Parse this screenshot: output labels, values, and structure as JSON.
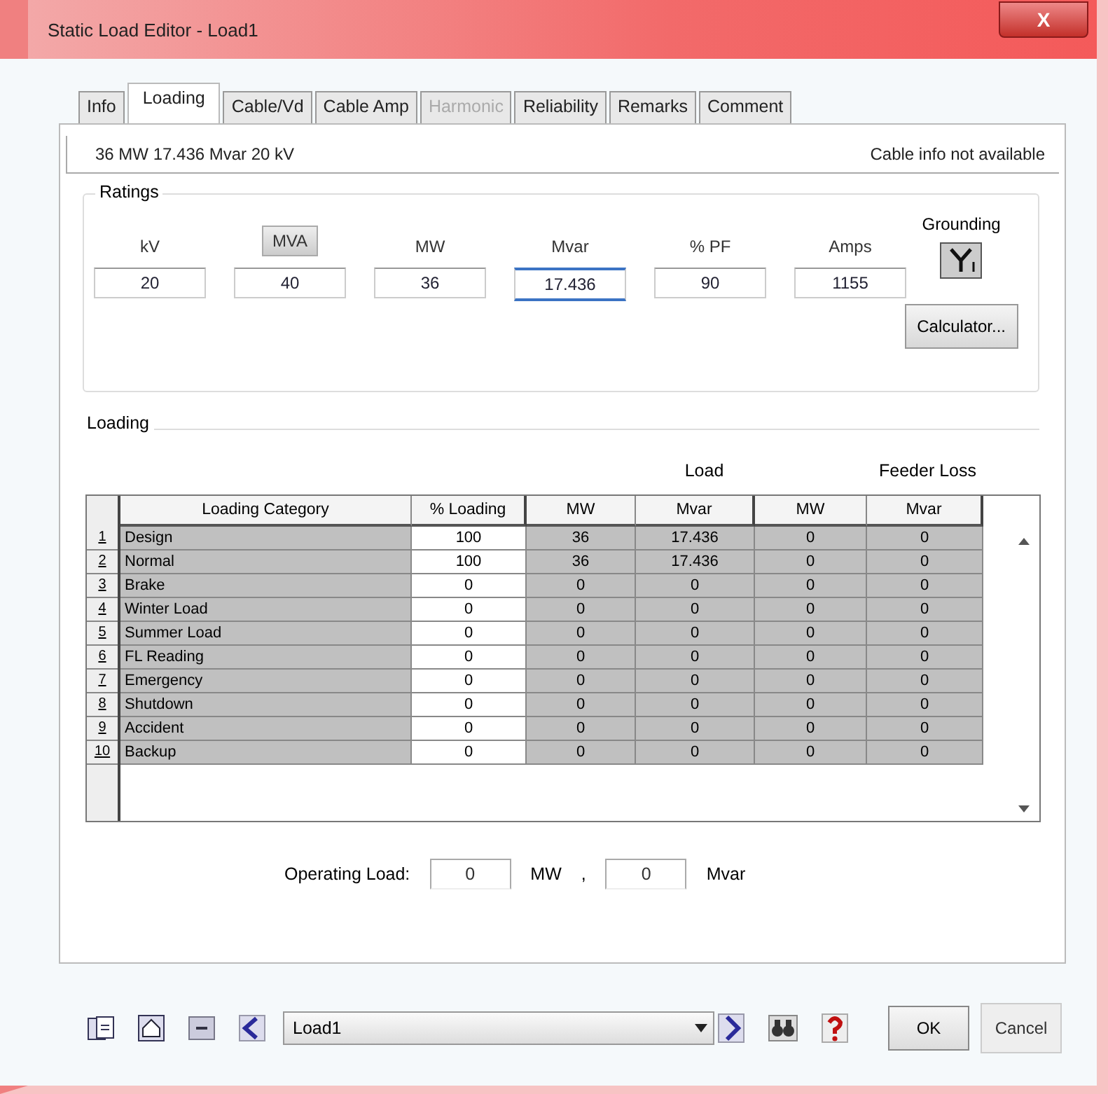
{
  "window": {
    "title": "Static Load Editor - Load1",
    "close": "X"
  },
  "tabs": [
    {
      "label": "Info",
      "selected": false,
      "disabled": false
    },
    {
      "label": "Loading",
      "selected": true,
      "disabled": false
    },
    {
      "label": "Cable/Vd",
      "selected": false,
      "disabled": false
    },
    {
      "label": "Cable Amp",
      "selected": false,
      "disabled": false
    },
    {
      "label": "Harmonic",
      "selected": false,
      "disabled": true
    },
    {
      "label": "Reliability",
      "selected": false,
      "disabled": false
    },
    {
      "label": "Remarks",
      "selected": false,
      "disabled": false
    },
    {
      "label": "Comment",
      "selected": false,
      "disabled": false
    }
  ],
  "summary": {
    "text": "36 MW   17.436 Mvar   20 kV",
    "cable_info": "Cable info not available"
  },
  "ratings": {
    "title": "Ratings",
    "fields": [
      {
        "label": "kV",
        "kind": "label",
        "value": "20",
        "focused": false
      },
      {
        "label": "MVA",
        "kind": "button",
        "value": "40",
        "focused": false
      },
      {
        "label": "MW",
        "kind": "label",
        "value": "36",
        "focused": false
      },
      {
        "label": "Mvar",
        "kind": "label",
        "value": "17.436",
        "focused": true
      },
      {
        "label": "% PF",
        "kind": "label",
        "value": "90",
        "focused": false
      },
      {
        "label": "Amps",
        "kind": "label",
        "value": "1155",
        "focused": false
      }
    ],
    "grounding_label": "Grounding",
    "calculator": "Calculator..."
  },
  "loading": {
    "title": "Loading",
    "group_headers": [
      "Load",
      "Feeder Loss"
    ],
    "columns": [
      "Loading Category",
      "% Loading",
      "MW",
      "Mvar",
      "MW",
      "Mvar"
    ],
    "rows": [
      {
        "index": "1",
        "cells": [
          "Design",
          "100",
          "36",
          "17.436",
          "0",
          "0"
        ]
      },
      {
        "index": "2",
        "cells": [
          "Normal",
          "100",
          "36",
          "17.436",
          "0",
          "0"
        ]
      },
      {
        "index": "3",
        "cells": [
          "Brake",
          "0",
          "0",
          "0",
          "0",
          "0"
        ]
      },
      {
        "index": "4",
        "cells": [
          "Winter Load",
          "0",
          "0",
          "0",
          "0",
          "0"
        ]
      },
      {
        "index": "5",
        "cells": [
          "Summer Load",
          "0",
          "0",
          "0",
          "0",
          "0"
        ]
      },
      {
        "index": "6",
        "cells": [
          "FL Reading",
          "0",
          "0",
          "0",
          "0",
          "0"
        ]
      },
      {
        "index": "7",
        "cells": [
          "Emergency",
          "0",
          "0",
          "0",
          "0",
          "0"
        ]
      },
      {
        "index": "8",
        "cells": [
          "Shutdown",
          "0",
          "0",
          "0",
          "0",
          "0"
        ]
      },
      {
        "index": "9",
        "cells": [
          "Accident",
          "0",
          "0",
          "0",
          "0",
          "0"
        ]
      },
      {
        "index": "10",
        "cells": [
          "Backup",
          "0",
          "0",
          "0",
          "0",
          "0"
        ]
      }
    ],
    "operating_load": {
      "label": "Operating Load:",
      "mw": "0",
      "mw_unit": "MW",
      "separator": ",",
      "mvar": "0",
      "mvar_unit": "Mvar"
    }
  },
  "toolbar": {
    "selector": "Load1",
    "ok": "OK",
    "cancel": "Cancel"
  }
}
